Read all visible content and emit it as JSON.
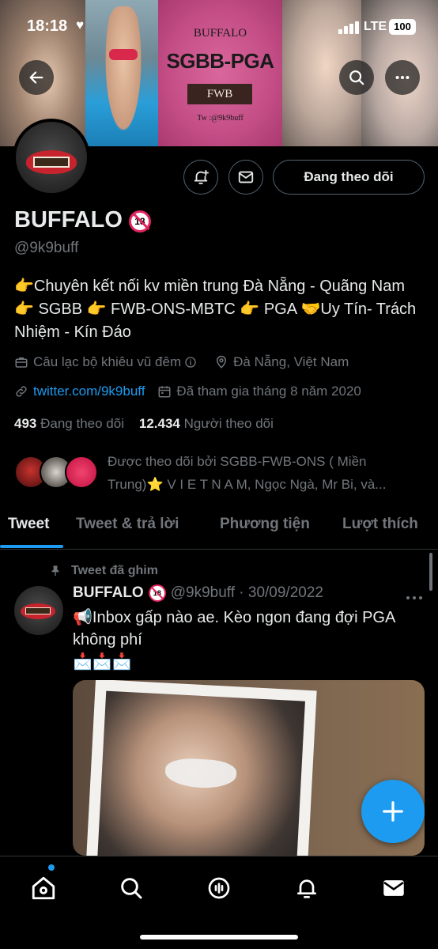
{
  "status_bar": {
    "time": "18:18",
    "network": "LTE",
    "battery": "100"
  },
  "banner": {
    "line1": "BUFFALO",
    "line2": "SGBB-PGA",
    "line3": "FWB",
    "line4": "Tw :@9k9buff"
  },
  "profile": {
    "follow_button_label": "Đang theo dõi",
    "name": "BUFFALO",
    "age_badge": "18",
    "handle": "@9k9buff",
    "bio": "👉Chuyên kết nối kv miền trung Đà Nẵng - Quãng Nam 👉 SGBB 👉 FWB-ONS-MBTC 👉 PGA 🤝Uy Tín- Trách Nhiệm - Kín Đáo",
    "category": "Câu lạc bộ khiêu vũ đêm",
    "location": "Đà Nẵng, Việt Nam",
    "website": "twitter.com/9k9buff",
    "joined": "Đã tham gia tháng 8 năm 2020",
    "following_count": "493",
    "following_label": "Đang theo dõi",
    "followers_count": "12.434",
    "followers_label": "Người theo dõi",
    "followed_by": "Được theo dõi bởi SGBB-FWB-ONS ( Miền Trung)⭐ V I E T N A M, Ngọc Ngà, Mr Bi, và..."
  },
  "tabs": [
    {
      "label": "Tweet"
    },
    {
      "label": "Tweet & trả lời"
    },
    {
      "label": "Phương tiện"
    },
    {
      "label": "Lượt thích"
    }
  ],
  "tweet": {
    "pinned_label": "Tweet đã ghim",
    "author": "BUFFALO",
    "age_badge": "18",
    "meta": "@9k9buff · 30/09/2022",
    "text": "📢Inbox gấp nào ae. Kèo ngon đang đợi PGA không phí",
    "emojis": "📩📩📩"
  },
  "icons": {
    "back": "back-arrow-icon",
    "search": "search-icon",
    "more": "more-icon",
    "notify": "bell-plus-icon",
    "message": "mail-icon",
    "nav": [
      "home-icon",
      "search-icon",
      "spaces-icon",
      "bell-icon",
      "mail-icon"
    ]
  },
  "colors": {
    "accent": "#1d9bf0",
    "background": "#000000",
    "muted": "#71767b",
    "text": "#e7e9ea"
  }
}
